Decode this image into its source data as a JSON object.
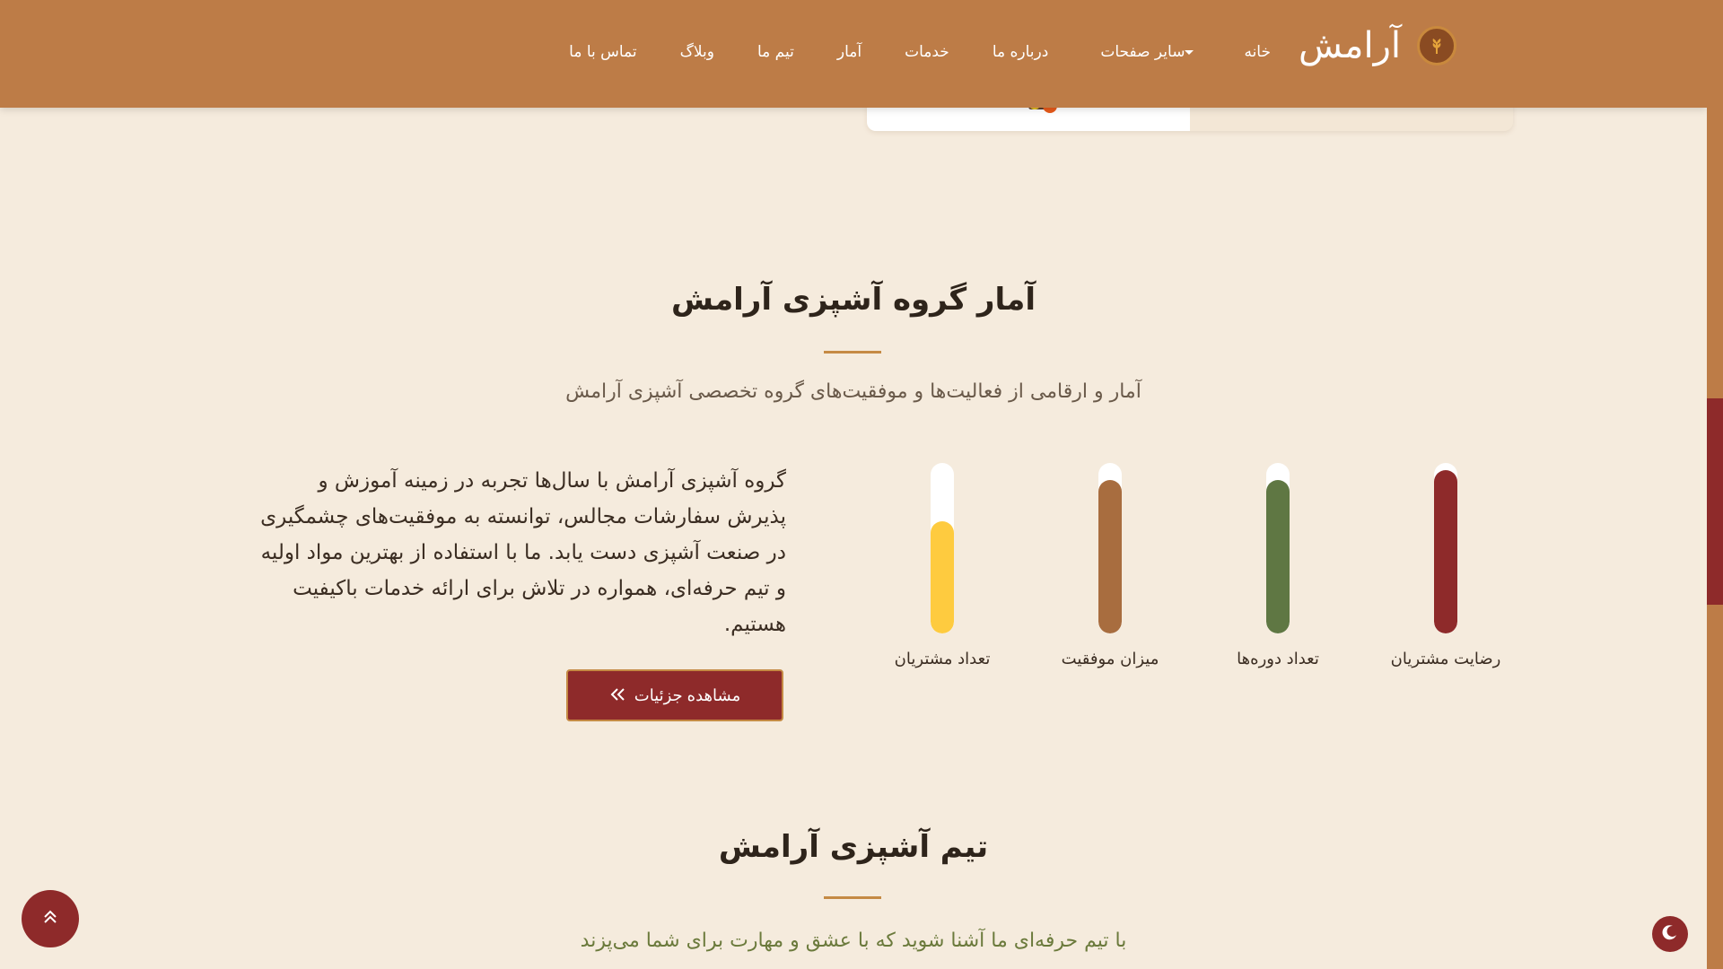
{
  "brand": {
    "name": "آرامش",
    "logo_icon": "wheat-icon"
  },
  "nav": {
    "items": [
      {
        "label": "خانه"
      },
      {
        "label": "سایر صفحات",
        "dropdown": true
      },
      {
        "label": "درباره ما"
      },
      {
        "label": "خدمات"
      },
      {
        "label": "آمار"
      },
      {
        "label": "تیم ما"
      },
      {
        "label": "وبلاگ"
      },
      {
        "label": "تماس با ما"
      }
    ]
  },
  "stats": {
    "title": "آمار گروه آشپزی آرامش",
    "subtitle": "آمار و ارقامی از فعالیت‌ها و موفقیت‌های گروه تخصصی آشپزی آرامش",
    "description": "گروه آشپزی آرامش با سال‌ها تجربه در زمینه آموزش و پذیرش سفارشات مجالس، توانسته به موفقیت‌های چشمگیری در صنعت آشپزی دست یابد. ما با استفاده از بهترین مواد اولیه و تیم حرفه‌ای، همواره در تلاش برای ارائه خدمات باکیفیت هستیم.",
    "button_label": "مشاهده جزئیات",
    "bars": [
      {
        "label": "رضایت مشتریان",
        "fill": 0.96,
        "color": "#8e2a2a"
      },
      {
        "label": "تعداد دوره‌ها",
        "fill": 0.9,
        "color": "#5f7743"
      },
      {
        "label": "میزان موفقیت",
        "fill": 0.9,
        "color": "#a86d3f"
      },
      {
        "label": "تعداد مشتریان",
        "fill": 0.66,
        "color": "#fecb3f"
      }
    ]
  },
  "team": {
    "title": "تیم آشپزی آرامش",
    "subtitle": "با تیم حرفه‌ای ما آشنا شوید که با عشق و مهارت برای شما می‌پزند"
  },
  "colors": {
    "navbar": "#bd7c47",
    "accent": "#8e2a2a",
    "background": "#f5ebdd"
  }
}
